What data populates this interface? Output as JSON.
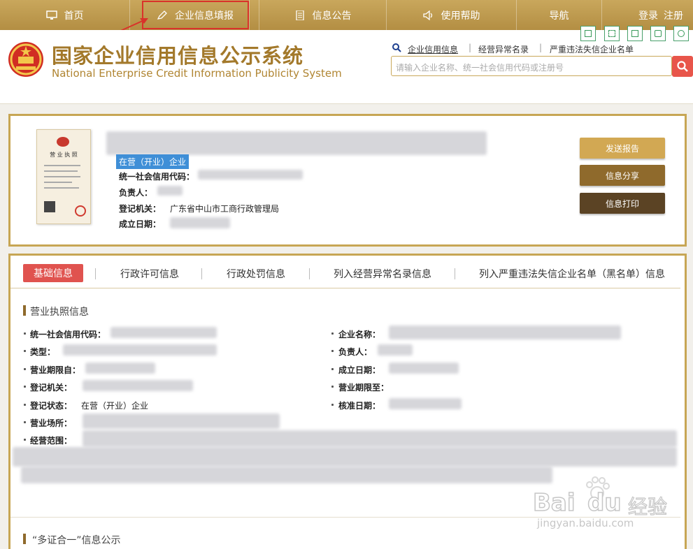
{
  "nav": {
    "items": [
      {
        "label": "首页",
        "icon": "monitor-icon"
      },
      {
        "label": "企业信息填报",
        "icon": "pen-icon"
      },
      {
        "label": "信息公告",
        "icon": "document-icon"
      },
      {
        "label": "使用帮助",
        "icon": "speaker-icon"
      },
      {
        "label": "导航"
      }
    ],
    "login": "登录",
    "register": "注册"
  },
  "header": {
    "title_cn": "国家企业信用信息公示系统",
    "title_en": "National Enterprise Credit Information Publicity System",
    "search_links": [
      "企业信用信息",
      "经营异常名录",
      "严重违法失信企业名单"
    ],
    "search_placeholder": "请输入企业名称、统一社会信用代码或注册号"
  },
  "license_image": {
    "text": "营 业 执 照"
  },
  "company": {
    "status": "在营（开业）企业",
    "fields": [
      {
        "label": "统一社会信用代码："
      },
      {
        "label": "负责人："
      },
      {
        "label": "登记机关：",
        "value": "广东省中山市工商行政管理局"
      },
      {
        "label": "成立日期："
      }
    ],
    "buttons": [
      "发送报告",
      "信息分享",
      "信息打印"
    ]
  },
  "tabs": [
    "基础信息",
    "行政许可信息",
    "行政处罚信息",
    "列入经营异常名录信息",
    "列入严重违法失信企业名单（黑名单）信息"
  ],
  "section": {
    "title": "营业执照信息",
    "left_fields": [
      {
        "label": "统一社会信用代码："
      },
      {
        "label": "类型："
      },
      {
        "label": "营业期限自："
      },
      {
        "label": "登记机关："
      },
      {
        "label": "登记状态：",
        "value": "在营（开业）企业"
      },
      {
        "label": "营业场所："
      },
      {
        "label": "经营范围："
      }
    ],
    "right_fields": [
      {
        "label": "企业名称："
      },
      {
        "label": "负责人："
      },
      {
        "label": "成立日期："
      },
      {
        "label": "营业期限至："
      },
      {
        "label": "核准日期："
      }
    ],
    "next_title": "“多证合一”信息公示"
  },
  "watermark": {
    "brand": "Bai",
    "brand2": "du",
    "suffix": "经验",
    "url": "jingyan.baidu.com"
  },
  "colors": {
    "gold": "#c29d4b",
    "active_tab": "#e0534f",
    "btn1": "#d2a853",
    "btn2": "#8f6a2c",
    "btn3": "#5b4324"
  }
}
